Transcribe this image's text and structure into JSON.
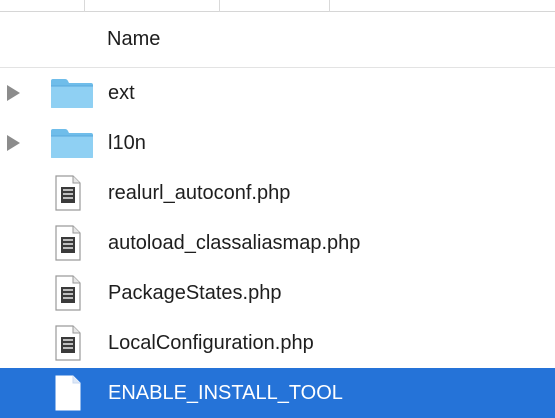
{
  "header": {
    "name_label": "Name"
  },
  "items": [
    {
      "label": "ext",
      "type": "folder",
      "expandable": true,
      "icon": "folder-icon"
    },
    {
      "label": "l10n",
      "type": "folder",
      "expandable": true,
      "icon": "folder-icon"
    },
    {
      "label": "realurl_autoconf.php",
      "type": "file",
      "expandable": false,
      "icon": "php-file-icon"
    },
    {
      "label": "autoload_classaliasmap.php",
      "type": "file",
      "expandable": false,
      "icon": "php-file-icon"
    },
    {
      "label": "PackageStates.php",
      "type": "file",
      "expandable": false,
      "icon": "php-file-icon"
    },
    {
      "label": "LocalConfiguration.php",
      "type": "file",
      "expandable": false,
      "icon": "php-file-icon"
    },
    {
      "label": "ENABLE_INSTALL_TOOL",
      "type": "file",
      "expandable": false,
      "icon": "blank-file-icon",
      "selected": true
    }
  ],
  "colors": {
    "selection": "#2573d8",
    "folder": "#7cc6ef",
    "text": "#1e1e1e",
    "disclosure": "#8c8c8c"
  }
}
